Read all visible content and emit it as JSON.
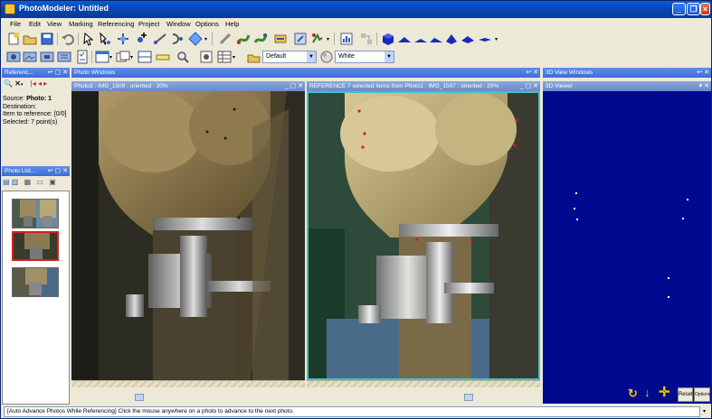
{
  "window": {
    "title": "PhotoModeler: Untitled"
  },
  "menu": [
    "File",
    "Edit",
    "View",
    "Marking",
    "Referencing",
    "Project",
    "Window",
    "Options",
    "Help"
  ],
  "toolbar": {
    "style_combo": "Default",
    "color_combo": "White"
  },
  "reference_pane": {
    "title": "Referenc...",
    "source_label": "Source:",
    "source_value": "Photo: 1",
    "destination_label": "Destination:",
    "item_label": "Item to reference:",
    "item_value": "[0/0]",
    "selected_label": "Selected: 7 point(s)"
  },
  "photo_list": {
    "title": "Photo List...",
    "items": [
      "1",
      "2",
      "3"
    ],
    "selected_index": 1
  },
  "photo_windows": {
    "title": "Photo Windows",
    "left_title": "Photo3 : IMG_1509 : oriented : 20%",
    "right_title": "REFERENCE 7 selected items from Photo1 : IMG_1507 : oriented : 20%"
  },
  "viewer3d": {
    "windows_title": "3D View Windows",
    "viewer_title": "3D Viewer",
    "reset_label": "Reset",
    "options_label": "Options",
    "colors": {
      "background": "#000a8f",
      "controls": "#f2c200"
    }
  },
  "status": {
    "text": "[Auto Advance Photos While Referencing] Click the mouse anywhere on a photo to advance to the next photo."
  }
}
